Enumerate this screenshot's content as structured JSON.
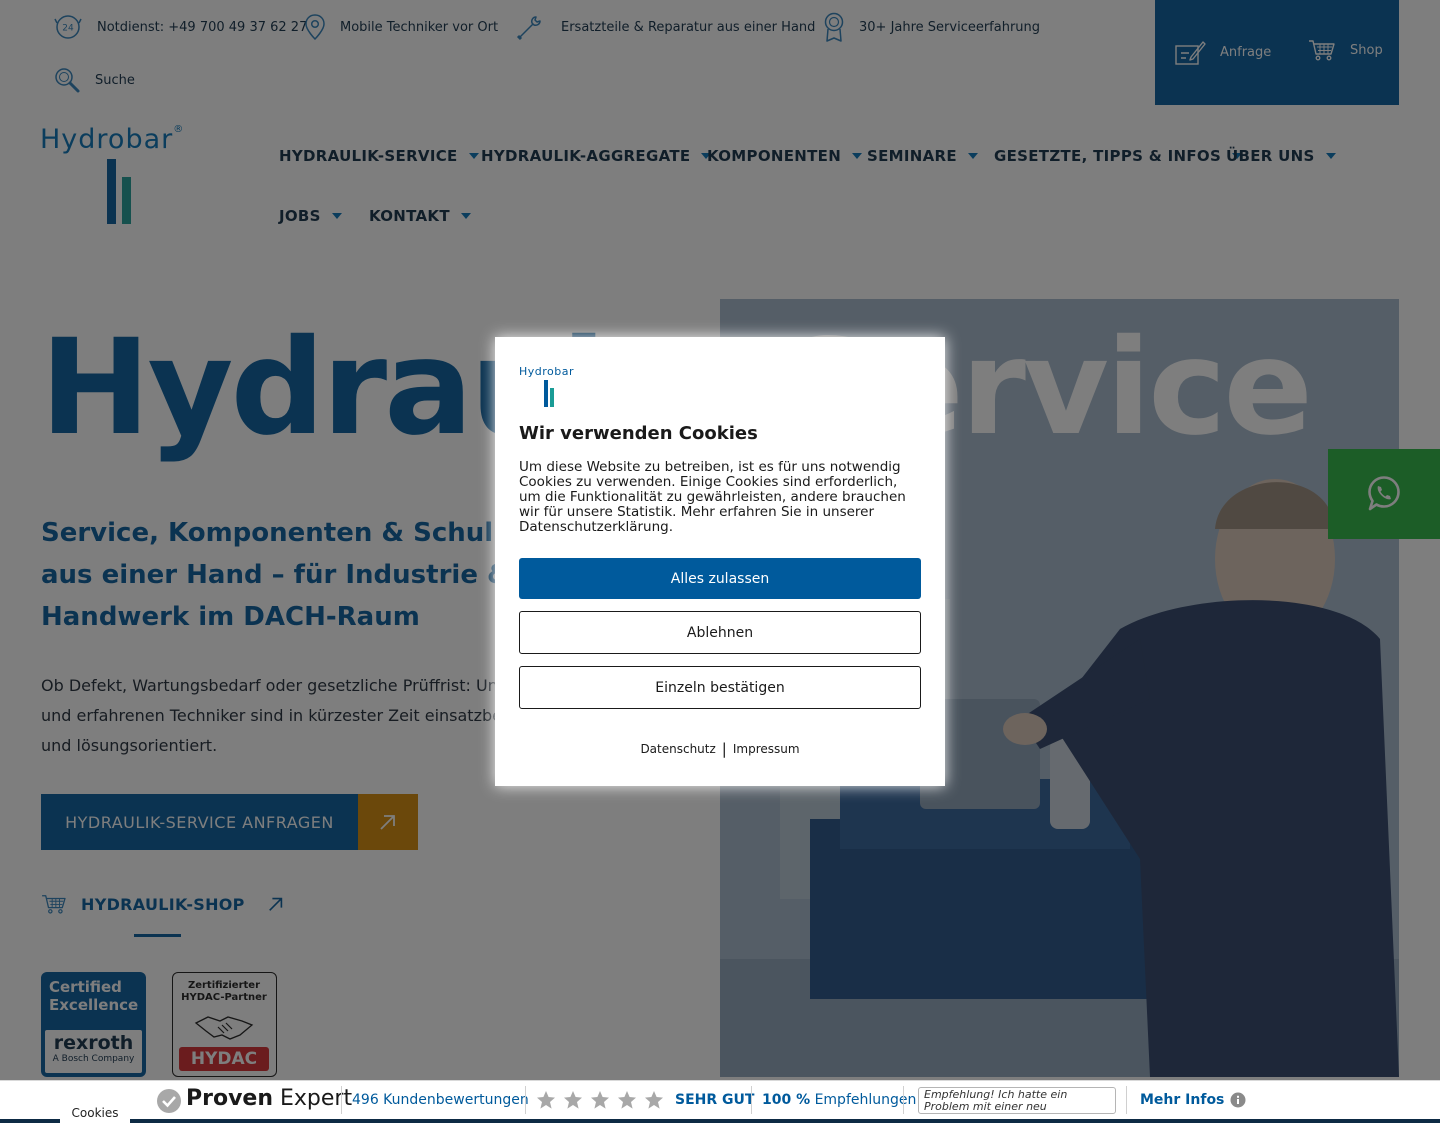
{
  "topbar": {
    "emergency": "Notdienst: +49 700 49 37 62 27",
    "mobile": "Mobile Techniker vor Ort",
    "parts": "Ersatzteile & Reparatur aus einer Hand",
    "experience": "30+ Jahre Serviceerfahrung",
    "search": "Suche",
    "inquiry": "Anfrage",
    "shop": "Shop",
    "clock_badge": "24"
  },
  "logo": {
    "text": "Hydrobar",
    "reg": "®"
  },
  "nav": {
    "items": [
      {
        "label": "HYDRAULIK-SERVICE"
      },
      {
        "label": "HYDRAULIK-AGGREGATE"
      },
      {
        "label": "KOMPONENTEN"
      },
      {
        "label": "SEMINARE"
      },
      {
        "label": "GESETZTE, TIPPS & INFOS"
      },
      {
        "label": "ÜBER UNS"
      },
      {
        "label": "JOBS"
      },
      {
        "label": "KONTAKT"
      }
    ]
  },
  "hero": {
    "title_part1": "Hydraul",
    "title_part2": "ik-Service",
    "subtitle": "Service, Komponenten & Schulungen aus einer Hand – für Industrie & Handwerk im DACH-Raum",
    "body": "Ob Defekt, Wartungsbedarf oder gesetzliche Prüffrist: Unsere geschulten und erfahrenen Techniker sind in kürzester Zeit einsatzbereit – kompetent und lösungsorientiert.",
    "cta_label": "HYDRAULIK-SERVICE ANFRAGEN",
    "shop_label": "HYDRAULIK-SHOP"
  },
  "badges": {
    "rexroth_line1": "Certified",
    "rexroth_line2": "Excellence",
    "rexroth_brand": "rexroth",
    "rexroth_sub": "A Bosch Company",
    "hydac_line1": "Zertifizierter",
    "hydac_line2": "HYDAC-Partner",
    "hydac_brand": "HYDAC"
  },
  "cookie_modal": {
    "logo_text": "Hydrobar",
    "title": "Wir verwenden Cookies",
    "text": "Um diese Website zu betreiben, ist es für uns notwendig Cookies zu verwenden. Einige Cookies sind erforderlich, um die Funktionalität zu gewährleisten, andere brauchen wir für unsere Statistik. Mehr erfahren Sie in unserer Datenschutzerklärung.",
    "accept": "Alles zulassen",
    "decline": "Ablehnen",
    "individual": "Einzeln bestätigen",
    "privacy_link": "Datenschutz",
    "separator": "|",
    "imprint_link": "Impressum"
  },
  "bottombar": {
    "cookies_tab": "Cookies",
    "brand_bold": "Proven",
    "brand_light": "Expert",
    "reviews": "496 Kundenbewertungen",
    "rating_text": "SEHR GUT",
    "recommend_value": "100 %",
    "recommend_label": "Empfehlungen",
    "quote": "Empfehlung! Ich hatte ein Problem mit einer neu installierten Klima...",
    "more_info": "Mehr Infos",
    "stars": 5
  },
  "colors": {
    "brand_blue": "#005a9c",
    "accent_orange": "#d68800",
    "whatsapp_green": "#27b53f",
    "brand_teal": "#1a9c96"
  }
}
